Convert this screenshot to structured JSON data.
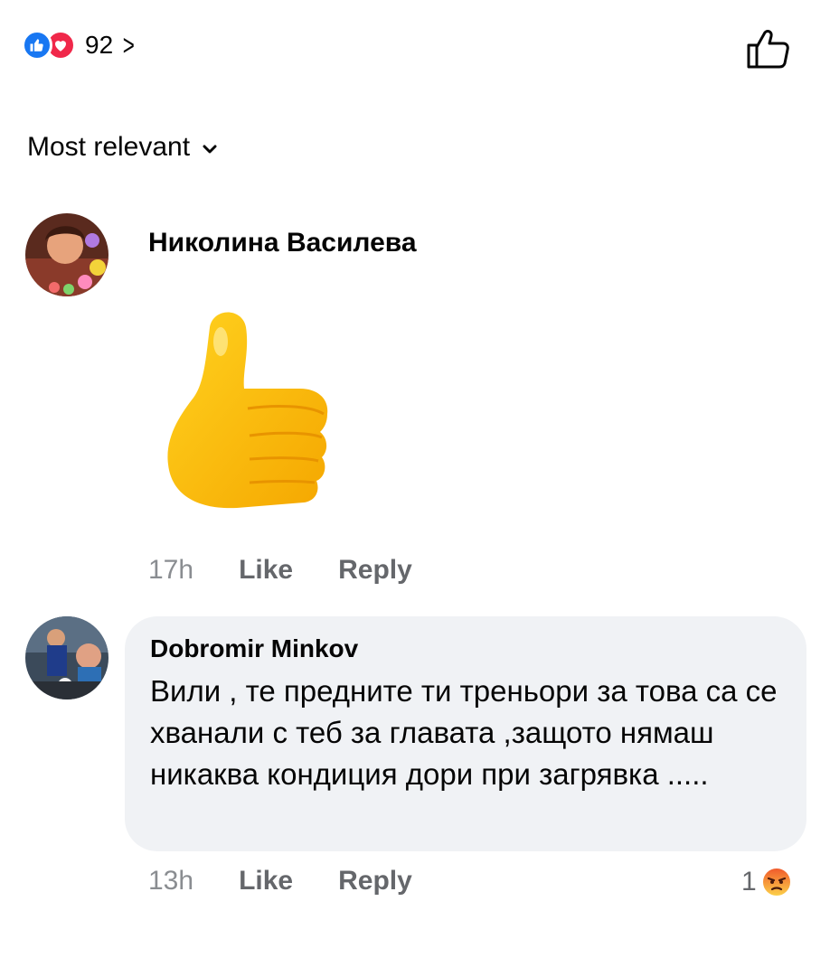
{
  "post_reactions": {
    "count": "92",
    "icons": [
      "like-icon",
      "love-icon"
    ],
    "colors": {
      "like": "#1877f2",
      "love": "#f0284a"
    }
  },
  "sort": {
    "label": "Most relevant"
  },
  "comments": [
    {
      "author": "Николина Василева",
      "content_type": "sticker",
      "sticker": "thumbs-up-icon",
      "time": "17h",
      "like_label": "Like",
      "reply_label": "Reply"
    },
    {
      "author": "Dobromir Minkov",
      "text": "Вили , те предните ти треньори за това са се хванали с теб за главата ,защото нямаш никаква кондиция дори при загрявка .....",
      "time": "13h",
      "like_label": "Like",
      "reply_label": "Reply",
      "reaction_count": "1",
      "reaction_icon": "angry-icon"
    }
  ]
}
